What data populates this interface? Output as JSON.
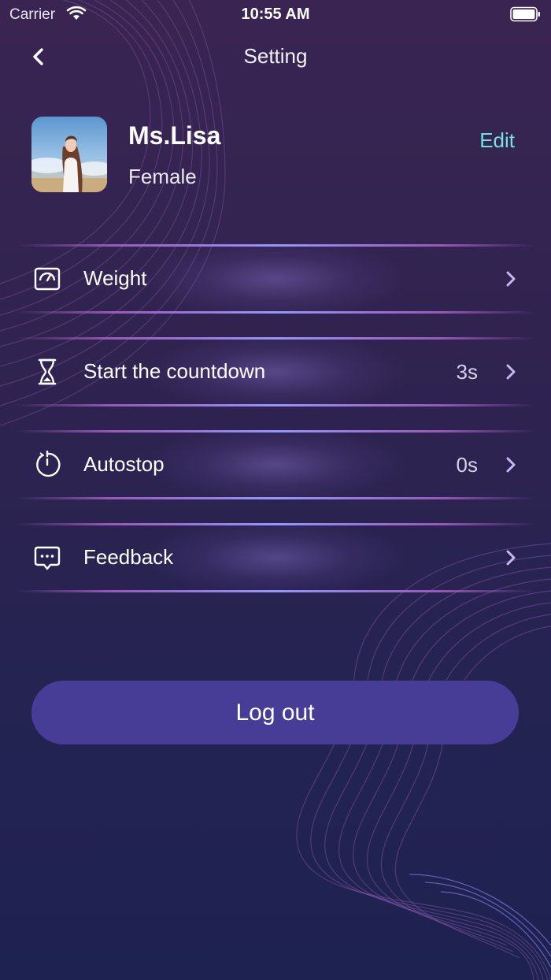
{
  "status_bar": {
    "carrier": "Carrier",
    "time": "10:55 AM"
  },
  "nav": {
    "title": "Setting",
    "back_icon": "chevron-left-icon"
  },
  "profile": {
    "name": "Ms.Lisa",
    "gender": "Female",
    "edit_label": "Edit"
  },
  "settings": {
    "items": [
      {
        "label": "Weight",
        "value": "",
        "icon": "weight-scale-icon"
      },
      {
        "label": "Start the countdown",
        "value": "3s",
        "icon": "hourglass-icon"
      },
      {
        "label": "Autostop",
        "value": "0s",
        "icon": "timer-icon"
      },
      {
        "label": "Feedback",
        "value": "",
        "icon": "chat-bubble-icon"
      }
    ]
  },
  "logout": {
    "label": "Log out"
  },
  "colors": {
    "accent": "#6fe3df",
    "button": "#473c96",
    "background_top": "#3a2452",
    "background_bottom": "#1e2250"
  }
}
